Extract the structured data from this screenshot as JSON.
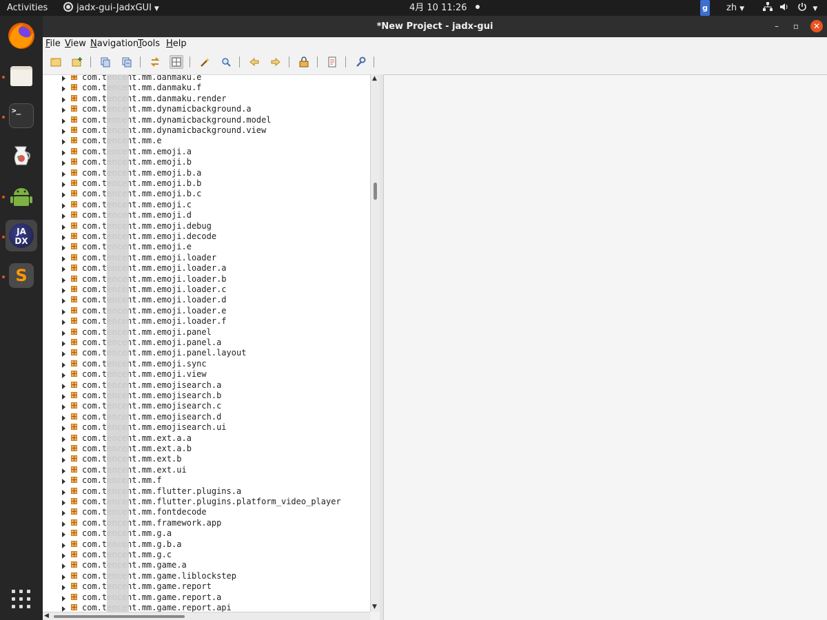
{
  "topbar": {
    "activities": "Activities",
    "app_menu": "jadx-gui-JadxGUI",
    "clock": "4月 10  11:26",
    "g_badge": "g",
    "lang": "zh",
    "icons": [
      "network-icon",
      "volume-icon",
      "power-icon"
    ]
  },
  "dock": {
    "apps": [
      "firefox",
      "files",
      "terminal",
      "jug-app",
      "android-studio",
      "jadx",
      "sublime-text"
    ],
    "jadx_label": "JA DX",
    "sublime_label": "S",
    "terminal_label": ">_"
  },
  "window": {
    "title": "*New Project - jadx-gui",
    "minimize": "–",
    "maximize": "▫",
    "close": "✕"
  },
  "menu": [
    {
      "first": "F",
      "rest": "ile"
    },
    {
      "first": "V",
      "rest": "iew"
    },
    {
      "first": "N",
      "rest": "avigation"
    },
    {
      "first": "T",
      "rest": "ools"
    },
    {
      "first": "H",
      "rest": "elp"
    }
  ],
  "toolbar": {
    "tools": [
      "open-file",
      "add-files",
      "save-all",
      "export",
      "sync",
      "flatten-packages",
      "text-search",
      "class-search",
      "back",
      "forward",
      "deobfuscation",
      "log-viewer",
      "preferences"
    ],
    "pressed": "flatten-packages",
    "accent": "#e9b24a"
  },
  "tree": {
    "rows": [
      "com.tencent.mm.danmaku.e",
      "com.tencent.mm.danmaku.f",
      "com.tencent.mm.danmaku.render",
      "com.tencent.mm.dynamicbackground.a",
      "com.tencent.mm.dynamicbackground.model",
      "com.tencent.mm.dynamicbackground.view",
      "com.tencent.mm.e",
      "com.tencent.mm.emoji.a",
      "com.tencent.mm.emoji.b",
      "com.tencent.mm.emoji.b.a",
      "com.tencent.mm.emoji.b.b",
      "com.tencent.mm.emoji.b.c",
      "com.tencent.mm.emoji.c",
      "com.tencent.mm.emoji.d",
      "com.tencent.mm.emoji.debug",
      "com.tencent.mm.emoji.decode",
      "com.tencent.mm.emoji.e",
      "com.tencent.mm.emoji.loader",
      "com.tencent.mm.emoji.loader.a",
      "com.tencent.mm.emoji.loader.b",
      "com.tencent.mm.emoji.loader.c",
      "com.tencent.mm.emoji.loader.d",
      "com.tencent.mm.emoji.loader.e",
      "com.tencent.mm.emoji.loader.f",
      "com.tencent.mm.emoji.panel",
      "com.tencent.mm.emoji.panel.a",
      "com.tencent.mm.emoji.panel.layout",
      "com.tencent.mm.emoji.sync",
      "com.tencent.mm.emoji.view",
      "com.tencent.mm.emojisearch.a",
      "com.tencent.mm.emojisearch.b",
      "com.tencent.mm.emojisearch.c",
      "com.tencent.mm.emojisearch.d",
      "com.tencent.mm.emojisearch.ui",
      "com.tencent.mm.ext.a.a",
      "com.tencent.mm.ext.a.b",
      "com.tencent.mm.ext.b",
      "com.tencent.mm.ext.ui",
      "com.tencent.mm.f",
      "com.tencent.mm.flutter.plugins.a",
      "com.tencent.mm.flutter.plugins.platform_video_player",
      "com.tencent.mm.fontdecode",
      "com.tencent.mm.framework.app",
      "com.tencent.mm.g.a",
      "com.tencent.mm.g.b.a",
      "com.tencent.mm.g.c",
      "com.tencent.mm.game.a",
      "com.tencent.mm.game.liblockstep",
      "com.tencent.mm.game.report",
      "com.tencent.mm.game.report.a",
      "com.tencent.mm.game.report.api"
    ]
  }
}
